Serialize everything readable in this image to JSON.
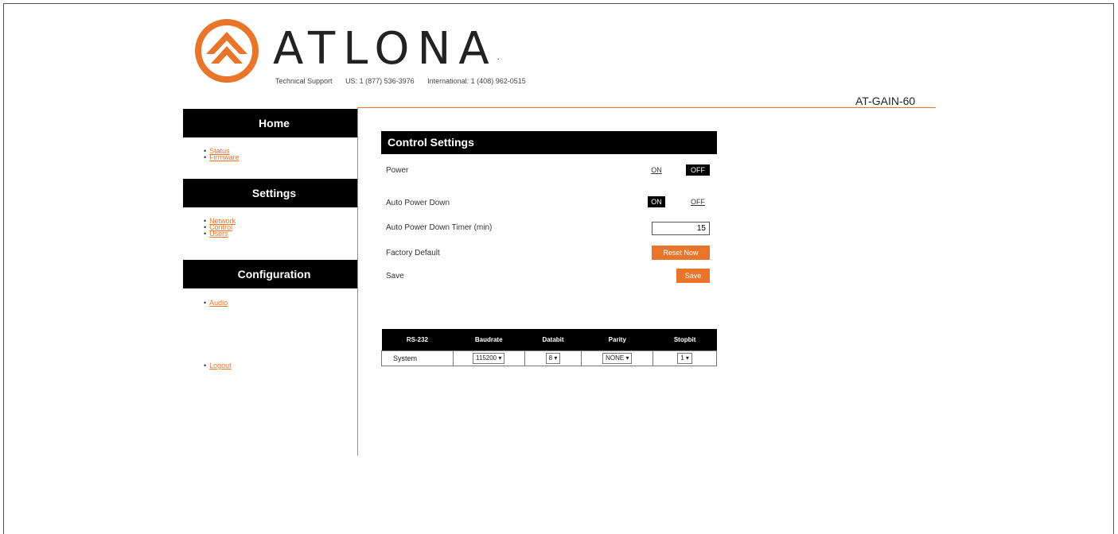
{
  "brand": {
    "name": "ATLONA",
    "trademark": ".",
    "support_label": "Technical Support",
    "us_phone": "US: 1 (877) 536-3976",
    "intl_phone": "International: 1 (408) 962-0515",
    "accent": "#e8752a",
    "logo_icon": "atlona-logo-icon"
  },
  "device_model": "AT-GAIN-60",
  "sidebar": {
    "home": {
      "title": "Home",
      "items": [
        {
          "label": "Status"
        },
        {
          "label": "Firmware"
        }
      ]
    },
    "settings": {
      "title": "Settings",
      "items": [
        {
          "label": "Network"
        },
        {
          "label": "Control"
        },
        {
          "label": "Users"
        }
      ]
    },
    "configuration": {
      "title": "Configuration",
      "items": [
        {
          "label": "Audio"
        }
      ]
    },
    "logout": "Logout"
  },
  "control_settings": {
    "title": "Control Settings",
    "power": {
      "label": "Power",
      "on": "ON",
      "off": "OFF",
      "selected": "OFF"
    },
    "auto_power_down": {
      "label": "Auto Power Down",
      "on": "ON",
      "off": "OFF",
      "selected": "ON"
    },
    "timer": {
      "label": "Auto Power Down Timer (min)",
      "value": "15"
    },
    "factory_default": {
      "label": "Factory Default",
      "button": "Reset Now"
    },
    "save": {
      "label": "Save",
      "button": "Save"
    }
  },
  "serial_table": {
    "headers": [
      "RS-232",
      "Baudrate",
      "Databit",
      "Parity",
      "Stopbit"
    ],
    "row": {
      "name": "System",
      "baudrate": "115200",
      "databit": "8",
      "parity": "NONE",
      "stopbit": "1"
    }
  }
}
